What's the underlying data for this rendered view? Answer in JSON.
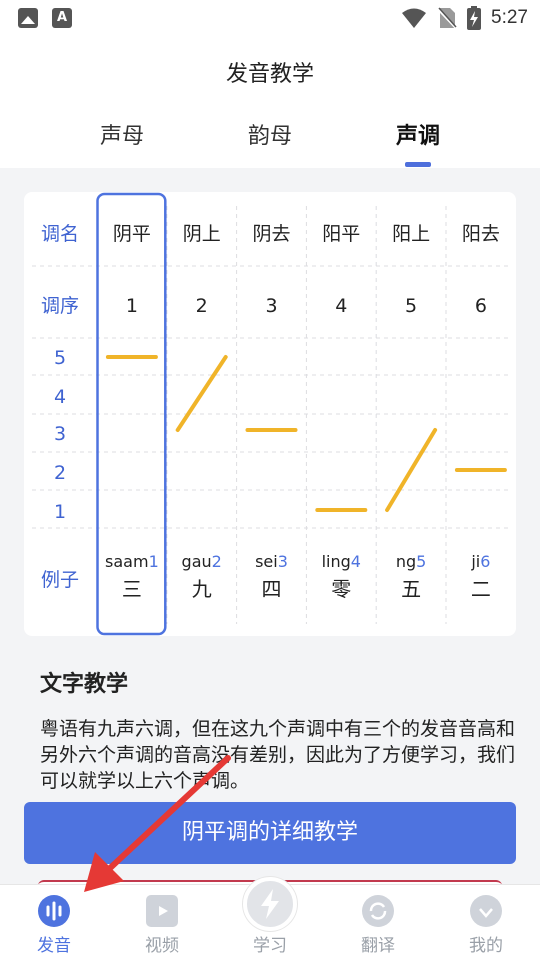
{
  "status_bar": {
    "time": "5:27",
    "left_icons": [
      "image-icon",
      "font-icon"
    ],
    "right_icons": [
      "wifi-icon",
      "no-sim-icon",
      "battery-charging-icon"
    ]
  },
  "page_title": "发音教学",
  "tabs": [
    {
      "label": "声母",
      "active": false
    },
    {
      "label": "韵母",
      "active": false
    },
    {
      "label": "声调",
      "active": true
    }
  ],
  "tone_chart": {
    "row_headers": {
      "name": "调名",
      "order": "调序",
      "example": "例子",
      "pitch_levels": [
        "5",
        "4",
        "3",
        "2",
        "1"
      ]
    },
    "tones": [
      {
        "name": "阴平",
        "order": "1",
        "example_roman": "saam",
        "example_num": "1",
        "example_char": "三",
        "pitch_start": 5,
        "pitch_end": 5,
        "selected": true
      },
      {
        "name": "阴上",
        "order": "2",
        "example_roman": "gau",
        "example_num": "2",
        "example_char": "九",
        "pitch_start": 3,
        "pitch_end": 5,
        "selected": false
      },
      {
        "name": "阴去",
        "order": "3",
        "example_roman": "sei",
        "example_num": "3",
        "example_char": "四",
        "pitch_start": 3,
        "pitch_end": 3,
        "selected": false
      },
      {
        "name": "阳平",
        "order": "4",
        "example_roman": "ling",
        "example_num": "4",
        "example_char": "零",
        "pitch_start": 1,
        "pitch_end": 1,
        "selected": false
      },
      {
        "name": "阳上",
        "order": "5",
        "example_roman": "ng",
        "example_num": "5",
        "example_char": "五",
        "pitch_start": 1,
        "pitch_end": 3,
        "selected": false
      },
      {
        "name": "阳去",
        "order": "6",
        "example_roman": "ji",
        "example_num": "6",
        "example_char": "二",
        "pitch_start": 2,
        "pitch_end": 2,
        "selected": false
      }
    ],
    "colors": {
      "header_blue": "#3f63d1",
      "contour": "#f0b429",
      "selected_border": "#4e73df",
      "example_num": "#4e73df"
    }
  },
  "text_teaching": {
    "title": "文字教学",
    "paragraph": "粤语有九声六调，但在这九个声调中有三个的发音音高和另外六个声调的音高没有差别，因此为了方便学习，我们可以就学以上六个声调。"
  },
  "detail_button": "阴平调的详细教学",
  "bottom_nav": [
    {
      "label": "发音",
      "icon": "sound-wave-icon",
      "active": true
    },
    {
      "label": "视频",
      "icon": "video-icon",
      "active": false
    },
    {
      "label": "学习",
      "icon": "lightning-icon",
      "active": false
    },
    {
      "label": "翻译",
      "icon": "refresh-icon",
      "active": false
    },
    {
      "label": "我的",
      "icon": "diamond-icon",
      "active": false
    }
  ],
  "colors": {
    "accent": "#4e73df",
    "annotation_arrow": "#e53935"
  }
}
